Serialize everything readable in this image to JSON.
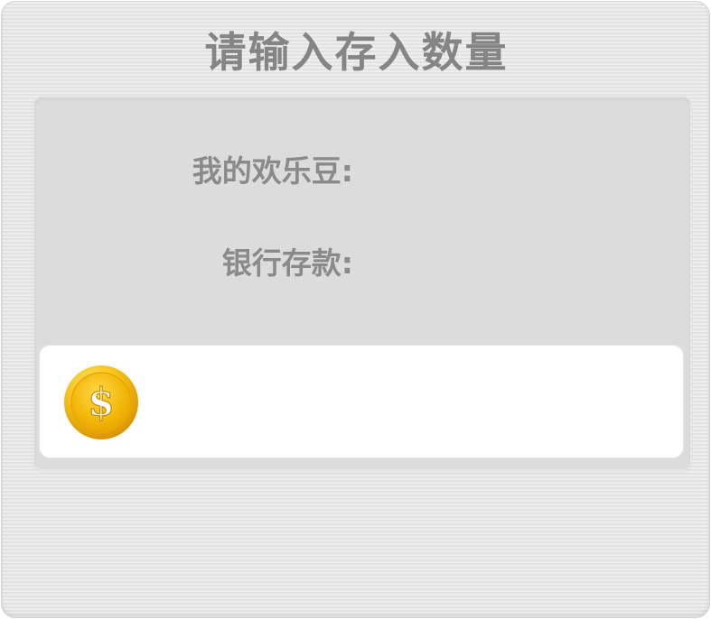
{
  "dialog": {
    "title": "请输入存入数量"
  },
  "balances": {
    "beans_label": "我的欢乐豆:",
    "beans_value": "",
    "bank_label": "银行存款:",
    "bank_value": ""
  },
  "amount_input": {
    "value": "",
    "placeholder": "",
    "icon": "coin-dollar-icon"
  },
  "colors": {
    "coin_gold": "#f6c21a",
    "label_gray": "#8a8a8a",
    "panel_gray": "#dcdcdc"
  }
}
